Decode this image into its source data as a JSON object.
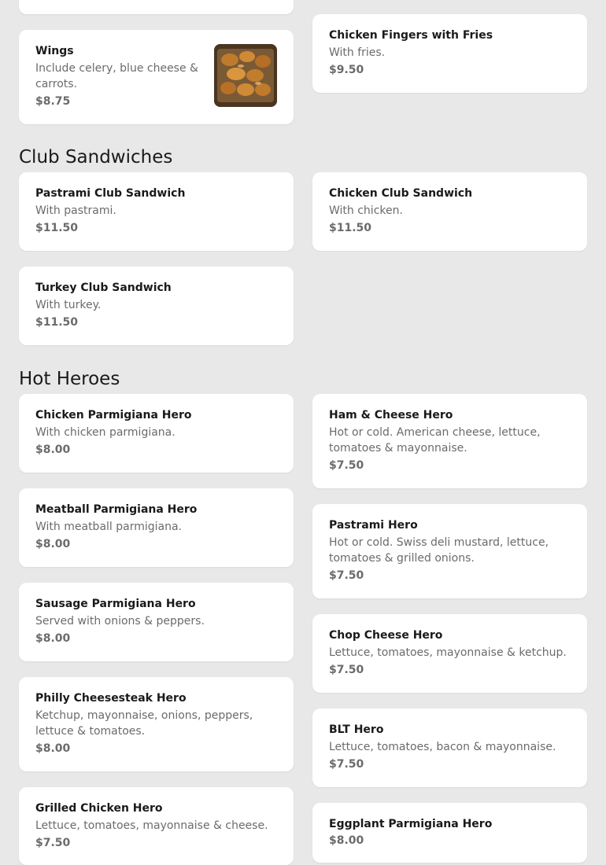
{
  "sections": {
    "club": "Club Sandwiches",
    "hot": "Hot Heroes"
  },
  "items": {
    "wings": {
      "name": "Wings",
      "desc": "Include celery, blue cheese & carrots.",
      "price": "$8.75"
    },
    "chicken_fingers": {
      "name": "Chicken Fingers with Fries",
      "desc": "With fries.",
      "price": "$9.50"
    },
    "pastrami_club": {
      "name": "Pastrami Club Sandwich",
      "desc": "With pastrami.",
      "price": "$11.50"
    },
    "chicken_club": {
      "name": "Chicken Club Sandwich",
      "desc": "With chicken.",
      "price": "$11.50"
    },
    "turkey_club": {
      "name": "Turkey Club Sandwich",
      "desc": "With turkey.",
      "price": "$11.50"
    },
    "chicken_parm": {
      "name": "Chicken Parmigiana Hero",
      "desc": "With chicken parmigiana.",
      "price": "$8.00"
    },
    "ham_cheese": {
      "name": "Ham & Cheese Hero",
      "desc": "Hot or cold. American cheese, lettuce, tomatoes & mayonnaise.",
      "price": "$7.50"
    },
    "meatball_parm": {
      "name": "Meatball Parmigiana Hero",
      "desc": "With meatball parmigiana.",
      "price": "$8.00"
    },
    "pastrami_hero": {
      "name": "Pastrami Hero",
      "desc": "Hot or cold. Swiss deli mustard, lettuce, tomatoes & grilled onions.",
      "price": "$7.50"
    },
    "sausage_parm": {
      "name": "Sausage Parmigiana Hero",
      "desc": "Served with onions & peppers.",
      "price": "$8.00"
    },
    "chop_cheese": {
      "name": "Chop Cheese Hero",
      "desc": "Lettuce, tomatoes, mayonnaise & ketchup.",
      "price": "$7.50"
    },
    "philly": {
      "name": "Philly Cheesesteak Hero",
      "desc": "Ketchup, mayonnaise, onions, peppers, lettuce & tomatoes.",
      "price": "$8.00"
    },
    "blt": {
      "name": "BLT Hero",
      "desc": "Lettuce, tomatoes, bacon & mayonnaise.",
      "price": "$7.50"
    },
    "grilled_chicken": {
      "name": "Grilled Chicken Hero",
      "desc": "Lettuce, tomatoes, mayonnaise & cheese.",
      "price": "$7.50"
    },
    "eggplant_parm": {
      "name": "Eggplant Parmigiana Hero",
      "price": "$8.00"
    }
  },
  "colors": {
    "background": "#e8e8e8",
    "card": "#ffffff",
    "name_text": "#1a1a1a",
    "secondary_text": "#6b6b6b"
  }
}
